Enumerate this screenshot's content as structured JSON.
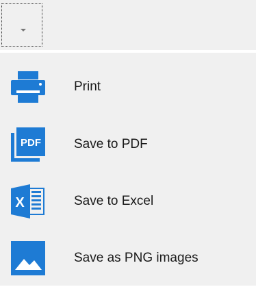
{
  "toolbar": {
    "dropdown_icon": "chevron-down-icon"
  },
  "menu": {
    "accent_color": "#1e7bd4",
    "items": [
      {
        "label": "Print",
        "icon": "printer-icon"
      },
      {
        "label": "Save to PDF",
        "icon": "pdf-icon",
        "icon_text": "PDF"
      },
      {
        "label": "Save to Excel",
        "icon": "excel-icon",
        "icon_text": "X"
      },
      {
        "label": "Save as PNG images",
        "icon": "image-icon"
      }
    ]
  }
}
